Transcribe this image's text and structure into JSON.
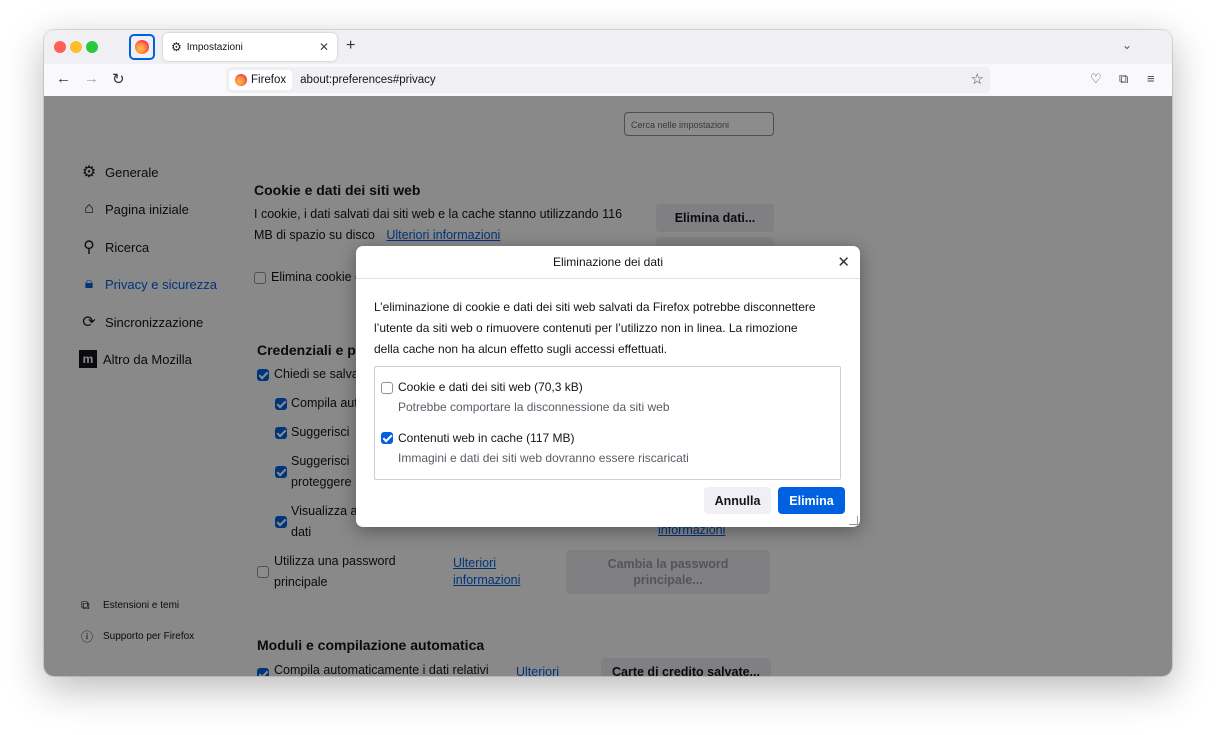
{
  "browser": {
    "tab_title": "Impostazioni",
    "identity_label": "Firefox",
    "url": "about:preferences#privacy",
    "icons": {
      "back": "back-icon",
      "forward": "forward-icon",
      "reload": "reload-icon",
      "bookmark": "star-icon",
      "pocket": "pocket-icon",
      "extensions": "puzzle-icon",
      "menu": "hamburger-icon"
    }
  },
  "settings": {
    "search_placeholder": "Cerca nelle impostazioni",
    "sidebar": {
      "items": [
        {
          "label": "Generale",
          "icon": "gear-icon"
        },
        {
          "label": "Pagina iniziale",
          "icon": "home-icon"
        },
        {
          "label": "Ricerca",
          "icon": "search-icon"
        },
        {
          "label": "Privacy e sicurezza",
          "icon": "lock-icon"
        },
        {
          "label": "Sincronizzazione",
          "icon": "sync-icon"
        },
        {
          "label": "Altro da Mozilla",
          "icon": "mozilla-icon"
        }
      ],
      "footer": [
        {
          "label": "Estensioni e temi",
          "icon": "puzzle-icon"
        },
        {
          "label": "Supporto per Firefox",
          "icon": "help-icon"
        }
      ]
    },
    "cookies": {
      "heading": "Cookie e dati dei siti web",
      "line1": "I cookie, i dati salvati dai siti web e la cache stanno utilizzando 116",
      "line2": "MB di spazio su disco",
      "learn_more": "Ulteriori informazioni",
      "clear_button": "Elimina dati...",
      "delete_on_close": "Elimina cookie e"
    },
    "credentials": {
      "heading": "Credenziali e pa",
      "ask_save": "Chiedi se salva",
      "autofill": "Compila aut",
      "suggest": "Suggerisci",
      "suggest_protect_1": "Suggerisci",
      "suggest_protect_2": "proteggere",
      "show_1": "Visualizza a",
      "show_2": "dati",
      "info_link": "informazioni",
      "primary_pw_1": "Utilizza una password",
      "primary_pw_2": "principale",
      "primary_link_1": "Ulteriori",
      "primary_link_2": "informazioni",
      "change_primary_1": "Cambia la password",
      "change_primary_2": "principale..."
    },
    "forms": {
      "heading": "Moduli e compilazione automatica",
      "autofill_label": "Compila automaticamente i dati relativi",
      "link": "Ulteriori",
      "saved_cards": "Carte di credito salvate..."
    }
  },
  "dialog": {
    "title": "Eliminazione dei dati",
    "desc_line1": "L’eliminazione di cookie e dati dei siti web salvati da Firefox potrebbe disconnettere",
    "desc_line2": "l’utente da siti web o rimuovere contenuti per l’utilizzo non in linea. La rimozione",
    "desc_line3": "della cache non ha alcun effetto sugli accessi effettuati.",
    "options": [
      {
        "label": "Cookie e dati dei siti web (70,3 kB)",
        "description": "Potrebbe comportare la disconnessione da siti web",
        "checked": false
      },
      {
        "label": "Contenuti web in cache (117 MB)",
        "description": "Immagini e dati dei siti web dovranno essere riscaricati",
        "checked": true
      }
    ],
    "cancel": "Annulla",
    "confirm": "Elimina"
  }
}
